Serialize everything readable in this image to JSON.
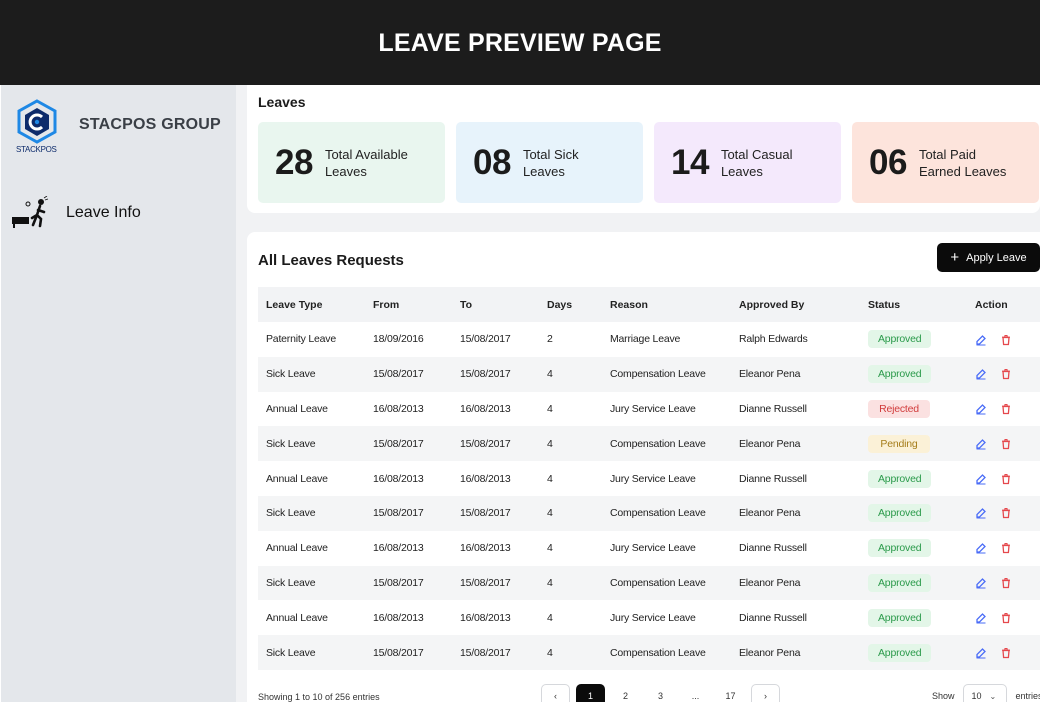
{
  "page": {
    "title": "LEAVE PREVIEW PAGE"
  },
  "sidebar": {
    "brand": "STACPOS GROUP",
    "logo_text": "STACKPOS",
    "items": [
      {
        "label": "Leave Info",
        "icon": "person-leaving-desk-icon"
      }
    ]
  },
  "leaves": {
    "title": "Leaves",
    "stats": [
      {
        "value": "28",
        "label": "Total Available Leaves",
        "color": "#e9f6ef"
      },
      {
        "value": "08",
        "label": "Total Sick Leaves",
        "color": "#e7f3fb"
      },
      {
        "value": "14",
        "label": "Total Casual Leaves",
        "color": "#f4e9fc"
      },
      {
        "value": "06",
        "label": "Total Paid Earned Leaves",
        "color": "#fde4dc"
      }
    ]
  },
  "requests": {
    "title": "All Leaves Requests",
    "apply_label": "Apply Leave",
    "columns": [
      "Leave Type",
      "From",
      "To",
      "Days",
      "Reason",
      "Approved By",
      "Status",
      "Action"
    ],
    "rows": [
      [
        "Paternity Leave",
        "18/09/2016",
        "15/08/2017",
        "2",
        "Marriage Leave",
        "Ralph Edwards",
        "Approved"
      ],
      [
        "Sick Leave",
        "15/08/2017",
        "15/08/2017",
        "4",
        "Compensation Leave",
        "Eleanor Pena",
        "Approved"
      ],
      [
        "Annual Leave",
        "16/08/2013",
        "16/08/2013",
        "4",
        "Jury Service Leave",
        "Dianne Russell",
        "Rejected"
      ],
      [
        "Sick Leave",
        "15/08/2017",
        "15/08/2017",
        "4",
        "Compensation Leave",
        "Eleanor Pena",
        "Pending"
      ],
      [
        "Annual Leave",
        "16/08/2013",
        "16/08/2013",
        "4",
        "Jury Service Leave",
        "Dianne Russell",
        "Approved"
      ],
      [
        "Sick Leave",
        "15/08/2017",
        "15/08/2017",
        "4",
        "Compensation Leave",
        "Eleanor Pena",
        "Approved"
      ],
      [
        "Annual Leave",
        "16/08/2013",
        "16/08/2013",
        "4",
        "Jury Service Leave",
        "Dianne Russell",
        "Approved"
      ],
      [
        "Sick Leave",
        "15/08/2017",
        "15/08/2017",
        "4",
        "Compensation Leave",
        "Eleanor Pena",
        "Approved"
      ],
      [
        "Annual Leave",
        "16/08/2013",
        "16/08/2013",
        "4",
        "Jury Service Leave",
        "Dianne Russell",
        "Approved"
      ],
      [
        "Sick Leave",
        "15/08/2017",
        "15/08/2017",
        "4",
        "Compensation Leave",
        "Eleanor Pena",
        "Approved"
      ]
    ],
    "status_colors": {
      "Approved": "approved",
      "Rejected": "rejected",
      "Pending": "pending"
    },
    "action_icons": [
      "edit-icon",
      "trash-icon"
    ]
  },
  "footer": {
    "showing": "Showing 1 to 10 of 256 entries",
    "pages": [
      "1",
      "2",
      "3",
      "...",
      "17"
    ],
    "current_page": "1",
    "show_label": "Show",
    "page_size": "10",
    "entries_label": "entries"
  }
}
